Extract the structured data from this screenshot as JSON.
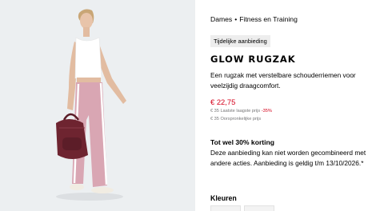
{
  "breadcrumb": {
    "category": "Dames",
    "separator": "•",
    "section": "Fitness en Training"
  },
  "badge": "Tijdelijke aanbieding",
  "product": {
    "name": "GLOW RUGZAK",
    "description": "Een rugzak met verstelbare schouderriemen voor veelzijdig draagcomfort."
  },
  "price": {
    "current": "€ 22,75",
    "lowest_label": "€ 35 Laatste laagste prijs",
    "discount": "-35%",
    "original_label": "€ 35 Oorspronkelijke prijs"
  },
  "promo": {
    "title": "Tot wel 30% korting",
    "text": "Deze aanbieding kan niet worden gecombineerd met andere acties. Aanbieding is geldig t/m 13/10/2026.*"
  },
  "colors": {
    "title": "Kleuren"
  },
  "theme": {
    "sale_red": "#d4001a",
    "muted_gray": "#767677",
    "photo_bg": "#eceff1",
    "pants_pink": "#d9a6b3",
    "bag_maroon": "#6e2430"
  }
}
